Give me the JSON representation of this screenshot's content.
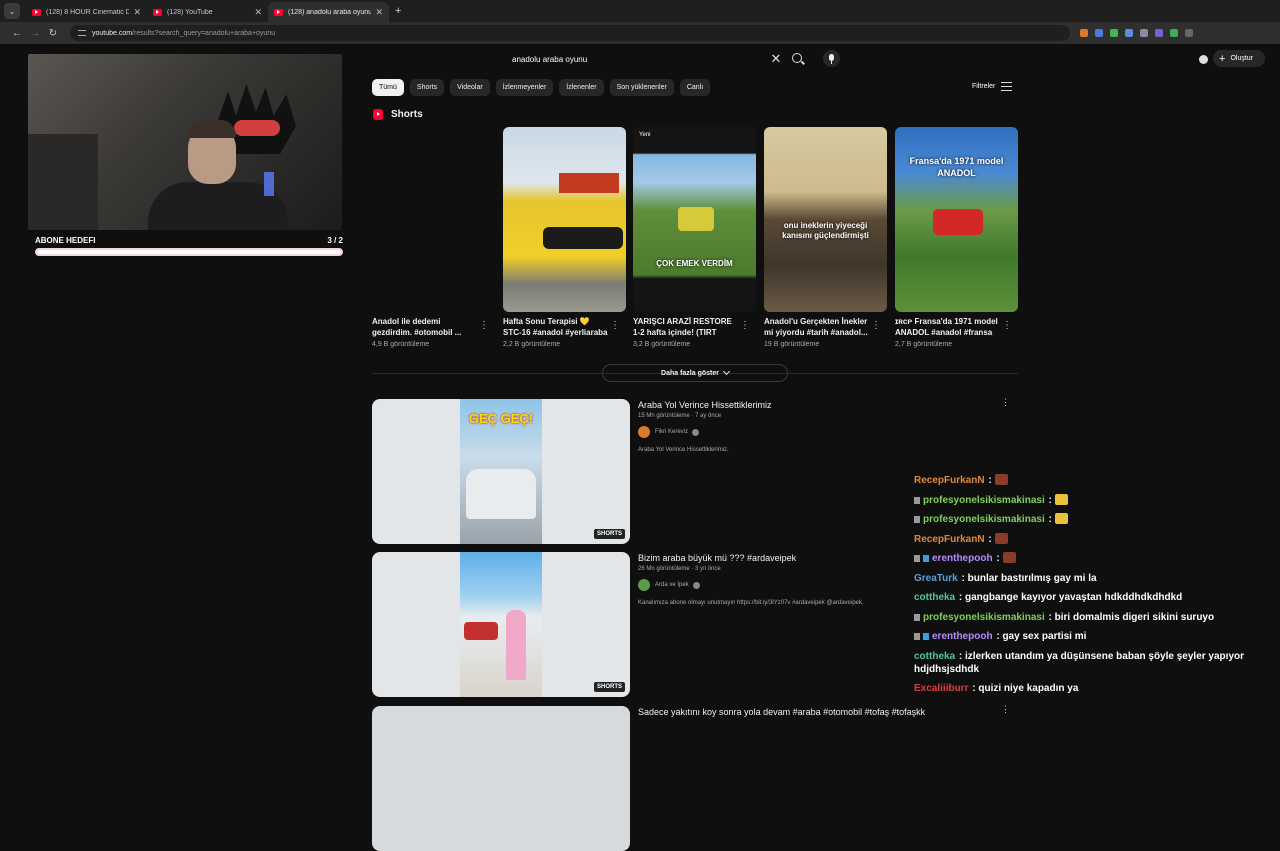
{
  "browser": {
    "tabs": [
      {
        "title": "(128) 8 HOUR Cinematic Drone",
        "active": false
      },
      {
        "title": "(128) YouTube",
        "active": false
      },
      {
        "title": "(128) anadolu araba oyunu - Yo",
        "active": true
      }
    ],
    "url_host": "youtube.com",
    "url_path": "/results?search_query=anadolu+araba+oyunu"
  },
  "stream_overlay": {
    "goal_label": "ABONE HEDEFI",
    "goal_count": "3 / 2",
    "goal_progress": 1.0
  },
  "youtube": {
    "search_query": "anadolu araba oyunu",
    "create_label": "Oluştur",
    "filters_label": "Filtreler",
    "chips": [
      "Tümü",
      "Shorts",
      "Videolar",
      "İzlenmeyenler",
      "İzlenenler",
      "Son yüklenenler",
      "Canlı"
    ],
    "shorts_section_title": "Shorts",
    "shorts": [
      {
        "title": "Anadol ile dedemi gezdirdim. #otomobil ...",
        "views": "4,9 B görüntüleme",
        "badge": "",
        "overlay": ""
      },
      {
        "title": "Hafta Sonu Terapisi 💛 STC-16 #anadol #yerliaraba",
        "views": "2,2 B görüntüleme",
        "badge": "",
        "overlay": ""
      },
      {
        "title": "YARIŞCI ARAZİ RESTORE 1-2 hafta içinde! (TIRT ARAB...",
        "views": "3,2 B görüntüleme",
        "badge": "Yeni",
        "overlay": "ÇOK EMEK VERDİM"
      },
      {
        "title": "Anadol'u Gerçekten İnekler mi yiyordu  #tarih #anadol...",
        "views": "19 B görüntüleme",
        "badge": "",
        "overlay": "onu ineklerin yiyeceği kanısını güçlendirmişti"
      },
      {
        "title": "ɪʀᴄᴘ Fransa'da 1971 model ANADOL #anadol #fransa ...",
        "views": "2,7 B görüntüleme",
        "badge": "",
        "overlay": "Fransa'da 1971 model ANADOL"
      }
    ],
    "show_more_label": "Daha fazla göster",
    "videos": [
      {
        "title": "Araba Yol Verince Hissettiklerimiz",
        "meta": "15 Mn görüntüleme · 7 ay önce",
        "channel": "Fikri Kereviz",
        "desc": "Araba Yol Verince Hissettiklerimiz.",
        "tag": "SHORTS",
        "overlay": "GEÇ GEÇ!"
      },
      {
        "title": "Bizim araba büyük mü ??? #ardaveipek",
        "meta": "26 Mn görüntüleme · 3 yıl önce",
        "channel": "Arda ve İpek",
        "desc": "Kanalımıza abone olmayı unutmayın https://bit.ly/3lYz07v #ardaveipek @ardaveipek.",
        "tag": "SHORTS",
        "overlay": ""
      },
      {
        "title": "Sadece yakıtını koy sonra yola devam #araba #otomobil #tofaş #tofaşkk",
        "meta": "",
        "channel": "",
        "desc": "",
        "tag": "",
        "overlay": ""
      }
    ]
  },
  "chat": [
    {
      "user": "RecepFurkanN",
      "color": "#e08a3c",
      "text": " :",
      "emote": "#8a3b2a",
      "badges": 0
    },
    {
      "user": "profesyonelsikismakinasi",
      "color": "#7fd15a",
      "text": " :",
      "emote": "#e8c23a",
      "badges": 1
    },
    {
      "user": "profesyonelsikismakinasi",
      "color": "#7fd15a",
      "text": " :",
      "emote": "#e8c23a",
      "badges": 1
    },
    {
      "user": "RecepFurkanN",
      "color": "#e08a3c",
      "text": " :",
      "emote": "#8a3b2a",
      "badges": 0
    },
    {
      "user": "erenthepooh",
      "color": "#b58cff",
      "text": " :",
      "emote": "#8a3b2a",
      "badges": 2
    },
    {
      "user": "GreaTurk",
      "color": "#5aa0d8",
      "text": " : bunlar bastırılmış gay mi la",
      "emote": "",
      "badges": 0
    },
    {
      "user": "cottheka",
      "color": "#4fc4a8",
      "text": " : gangbange kayıyor yavaştan hdkddhdkdhdkd",
      "emote": "",
      "badges": 0
    },
    {
      "user": "profesyonelsikismakinasi",
      "color": "#7fd15a",
      "text": " : biri domalmis digeri sikini suruyo",
      "emote": "",
      "badges": 1
    },
    {
      "user": "erenthepooh",
      "color": "#b58cff",
      "text": " : gay sex partisi mi",
      "emote": "",
      "badges": 2
    },
    {
      "user": "cottheka",
      "color": "#4fc4a8",
      "text": " : izlerken utandım ya düşünsene baban şöyle şeyler yapıyor hdjdhsjsdhdk",
      "emote": "",
      "badges": 0
    },
    {
      "user": "Excaliiiburr",
      "color": "#e23a3a",
      "text": " : quizi niye kapadın ya",
      "emote": "",
      "badges": 0
    }
  ]
}
